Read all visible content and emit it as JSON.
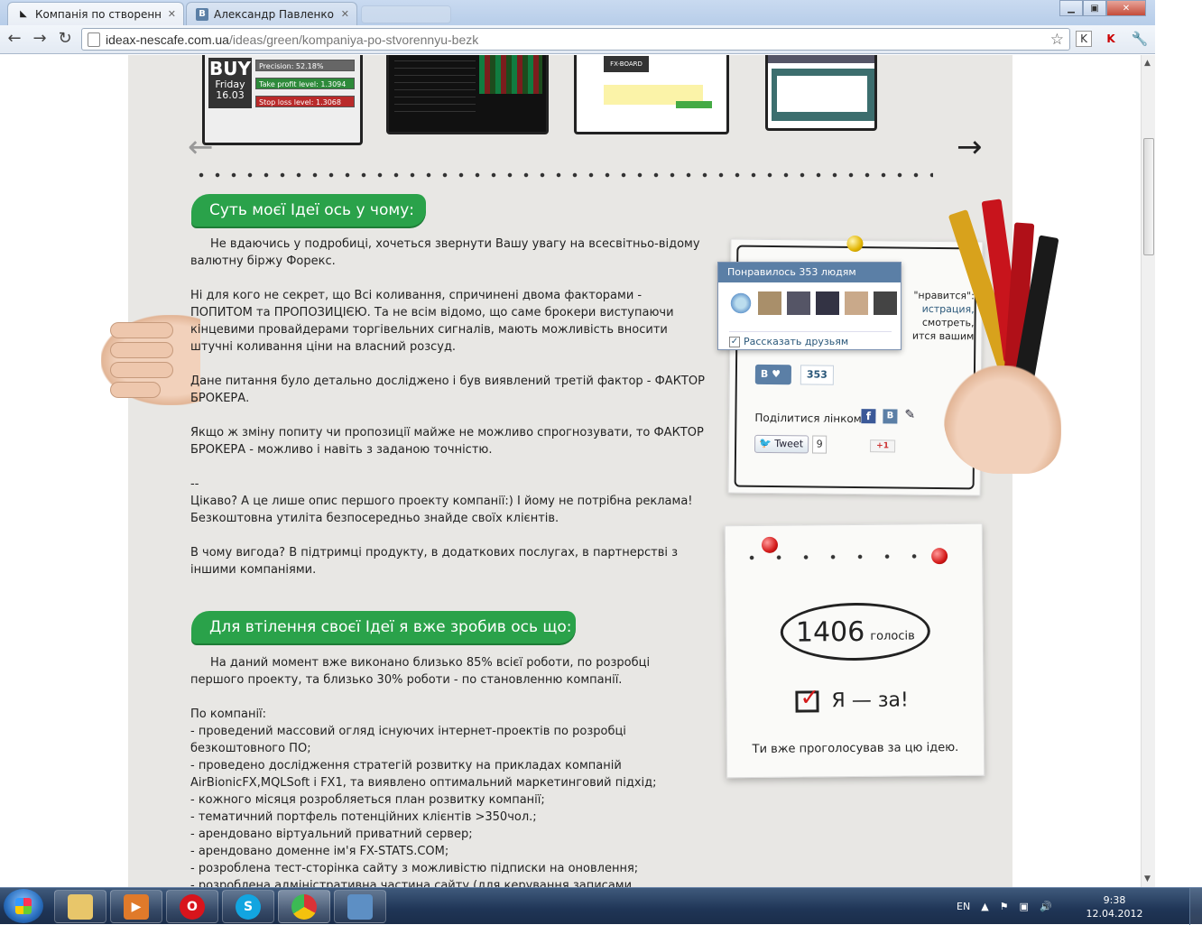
{
  "browser": {
    "tabs": [
      {
        "label": "Компанія по створенню бе",
        "active": true
      },
      {
        "label": "Александр Павленко",
        "active": false
      }
    ],
    "url_host": "ideax-nescafe.com.ua",
    "url_path": "/ideas/green/kompaniya-po-stvorennyu-bezk"
  },
  "gallery": {
    "shot1": {
      "buy": "BUY",
      "day": "Friday",
      "date": "16.03",
      "rows": [
        "Precision: 52.18%",
        "Take profit level: 1.3094",
        "Stop loss level: 1.3068"
      ]
    },
    "shot3_header": "FX-BOARD"
  },
  "section1": {
    "heading": "Суть моєї Ідеї ось у чому:",
    "paragraphs": [
      "Не вдаючись у подробиці, хочеться звернути Вашу увагу на всесвітньо-відому валютну біржу Форекс.",
      "Ні для кого не секрет, що Всі коливання, спричинені двома факторами - ПОПИТОМ та ПРОПОЗИЦІЄЮ. Та не всім відомо, що саме брокери виступаючи кінцевими провайдерами торгівельних сигналів, мають можливість вносити штучні коливання ціни на власний розсуд.",
      "Дане питання було детально досліджено і був виявлений третій фактор - ФАКТОР БРОКЕРА.",
      "Якщо ж зміну попиту чи пропозиції майже не можливо спрогнозувати, то ФАКТОР БРОКЕРА - можливо і навіть з заданою точністю.",
      "--\nЦікаво? А це лише опис першого проекту компанії:) І йому не потрібна реклама! Безкоштовна утиліта безпосередньо знайде своїх клієнтів.",
      "В чому вигода? В підтримці продукту, в додаткових послугах, в партнерстві з іншими компаніями."
    ]
  },
  "section2": {
    "heading": "Для втілення своєї Ідеї я вже зробив ось що:",
    "intro": "На даний момент вже виконано близько 85% всієї роботи, по розробці першого проекту, та близько 30% роботи - по становленню компанії.",
    "list_title": "По компанії:",
    "items": [
      "- проведений массовий огляд існуючих інтернет-проектів по розробці безкоштовного ПО;",
      "- проведено дослідження стратегій розвитку на прикладах компаній AirBionicFX,MQLSoft і FX1, та виявлено оптимальний маркетинговий підхід;",
      "- кожного місяця розробляеться план розвитку компанії;",
      "- тематичний портфель потенційних клієнтів >350чол.;",
      "- арендовано віртуальний приватний сервер;",
      "- арендовано доменне ім'я FX-STATS.COM;",
      "- розроблена тест-сторінка сайту з можливістю підписки на оновлення;",
      "- розроблена адміністративна частина сайту (для керування записами"
    ]
  },
  "vk_popup": {
    "header": "Понравилось 353 людям",
    "share_label": "Рассказать друзьям",
    "side_text_1": "\"нравится\":",
    "side_link": "истрация,",
    "side_text_2": "смотреть,",
    "side_text_3": "ится вашим"
  },
  "social": {
    "vk_count": "353",
    "share_link_label": "Поділитися лінком:",
    "tweet_label": "Tweet",
    "tweet_count": "9",
    "gplus_label": "+1"
  },
  "vote": {
    "count": "1406",
    "count_label": "голосів",
    "button_label": "Я — за!",
    "status": "Ти вже проголосував за цю ідею."
  },
  "taskbar": {
    "lang": "EN",
    "time": "9:38",
    "date": "12.04.2012"
  }
}
